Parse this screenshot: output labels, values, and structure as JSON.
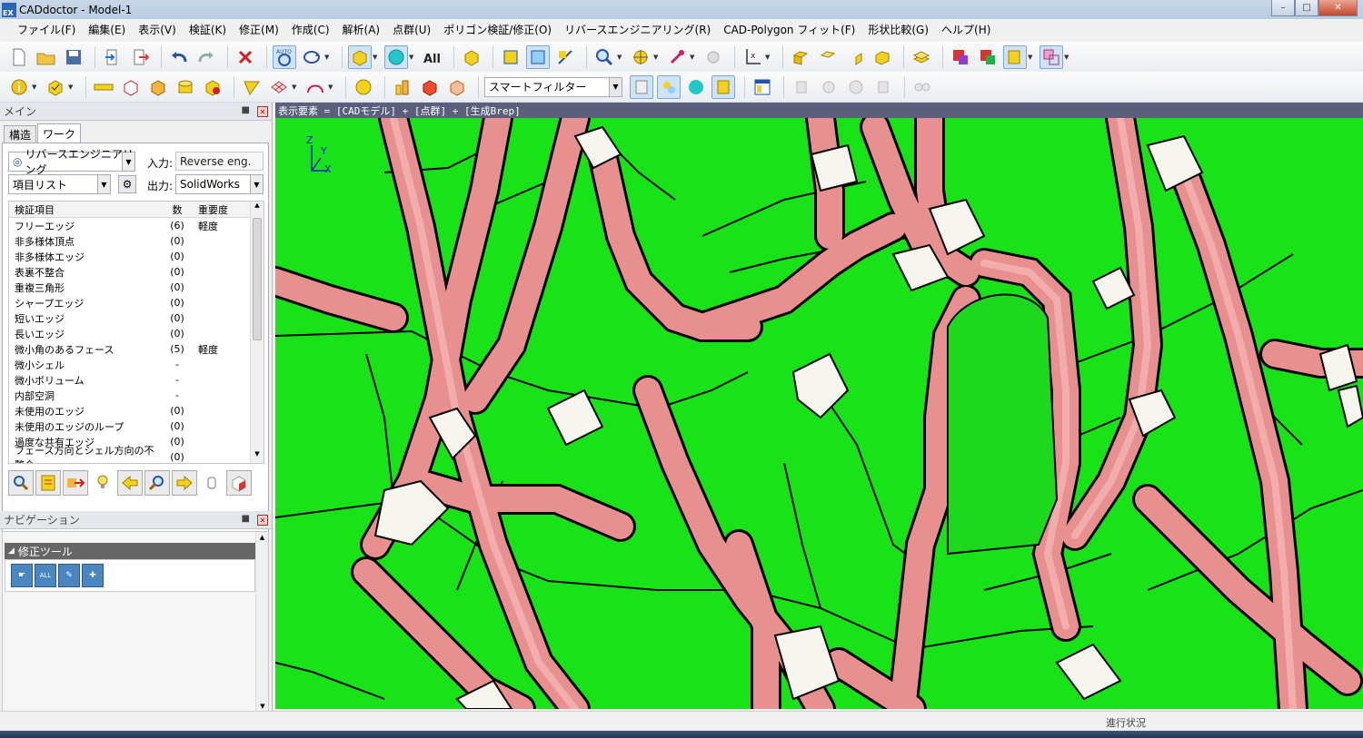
{
  "window": {
    "title": "CADdoctor - Model-1",
    "app_icon": "EX"
  },
  "menu": [
    "ファイル(F)",
    "編集(E)",
    "表示(V)",
    "検証(K)",
    "修正(M)",
    "作成(C)",
    "解析(A)",
    "点群(U)",
    "ポリゴン検証/修正(O)",
    "リバースエンジニアリング(R)",
    "CAD-Polygon フィット(F)",
    "形状比較(G)",
    "ヘルプ(H)"
  ],
  "toolbar": {
    "smart_filter": "スマートフィルター",
    "auto_label": "AUTO"
  },
  "main_panel": {
    "title": "メイン",
    "tabs": [
      "構造",
      "ワーク"
    ],
    "mode_select": "リバースエンジニアリング",
    "input_label": "入力:",
    "input_value": "Reverse eng.",
    "list_select": "項目リスト",
    "output_label": "出力:",
    "output_value": "SolidWorks",
    "columns": [
      "検証項目",
      "数",
      "重要度"
    ],
    "rows": [
      {
        "item": "フリーエッジ",
        "count": "(6)",
        "severity": "軽度"
      },
      {
        "item": "非多様体頂点",
        "count": "(0)",
        "severity": ""
      },
      {
        "item": "非多様体エッジ",
        "count": "(0)",
        "severity": ""
      },
      {
        "item": "表裏不整合",
        "count": "(0)",
        "severity": ""
      },
      {
        "item": "重複三角形",
        "count": "(0)",
        "severity": ""
      },
      {
        "item": "シャープエッジ",
        "count": "(0)",
        "severity": ""
      },
      {
        "item": "短いエッジ",
        "count": "(0)",
        "severity": ""
      },
      {
        "item": "長いエッジ",
        "count": "(0)",
        "severity": ""
      },
      {
        "item": "微小角のあるフェース",
        "count": "(5)",
        "severity": "軽度"
      },
      {
        "item": "微小シェル",
        "count": "-",
        "severity": ""
      },
      {
        "item": "微小ボリューム",
        "count": "-",
        "severity": ""
      },
      {
        "item": "内部空洞",
        "count": "-",
        "severity": ""
      },
      {
        "item": "未使用のエッジ",
        "count": "(0)",
        "severity": ""
      },
      {
        "item": "未使用のエッジのループ",
        "count": "(0)",
        "severity": ""
      },
      {
        "item": "過度な共有エッジ",
        "count": "(0)",
        "severity": ""
      },
      {
        "item": "フェース方向とシェル方向の不整合",
        "count": "(0)",
        "severity": ""
      }
    ]
  },
  "navigation_panel": {
    "title": "ナビゲーション",
    "section": "修正ツール",
    "all_label": "ALL"
  },
  "viewport": {
    "header": "表示要素 = [CADモデル] + [点群] + [生成Brep]",
    "axis_labels": {
      "x": "X",
      "y": "Y",
      "z": "Z"
    },
    "colors": {
      "background": "#17e317",
      "patch": "#00ee00",
      "fillet": "#e89090",
      "corner": "#f6f6ee",
      "edge": "#000000"
    }
  },
  "statusbar": {
    "progress_label": "進行状況"
  }
}
